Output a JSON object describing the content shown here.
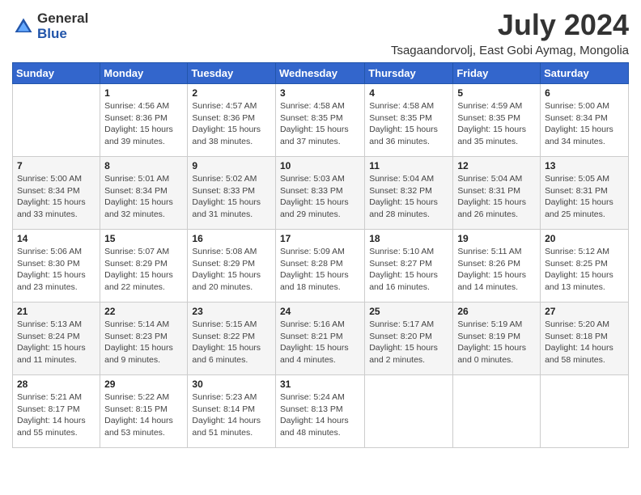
{
  "logo": {
    "general": "General",
    "blue": "Blue"
  },
  "title": "July 2024",
  "subtitle": "Tsagaandorvolj, East Gobi Aymag, Mongolia",
  "days_of_week": [
    "Sunday",
    "Monday",
    "Tuesday",
    "Wednesday",
    "Thursday",
    "Friday",
    "Saturday"
  ],
  "weeks": [
    [
      {
        "num": "",
        "info": ""
      },
      {
        "num": "1",
        "info": "Sunrise: 4:56 AM\nSunset: 8:36 PM\nDaylight: 15 hours\nand 39 minutes."
      },
      {
        "num": "2",
        "info": "Sunrise: 4:57 AM\nSunset: 8:36 PM\nDaylight: 15 hours\nand 38 minutes."
      },
      {
        "num": "3",
        "info": "Sunrise: 4:58 AM\nSunset: 8:35 PM\nDaylight: 15 hours\nand 37 minutes."
      },
      {
        "num": "4",
        "info": "Sunrise: 4:58 AM\nSunset: 8:35 PM\nDaylight: 15 hours\nand 36 minutes."
      },
      {
        "num": "5",
        "info": "Sunrise: 4:59 AM\nSunset: 8:35 PM\nDaylight: 15 hours\nand 35 minutes."
      },
      {
        "num": "6",
        "info": "Sunrise: 5:00 AM\nSunset: 8:34 PM\nDaylight: 15 hours\nand 34 minutes."
      }
    ],
    [
      {
        "num": "7",
        "info": "Sunrise: 5:00 AM\nSunset: 8:34 PM\nDaylight: 15 hours\nand 33 minutes."
      },
      {
        "num": "8",
        "info": "Sunrise: 5:01 AM\nSunset: 8:34 PM\nDaylight: 15 hours\nand 32 minutes."
      },
      {
        "num": "9",
        "info": "Sunrise: 5:02 AM\nSunset: 8:33 PM\nDaylight: 15 hours\nand 31 minutes."
      },
      {
        "num": "10",
        "info": "Sunrise: 5:03 AM\nSunset: 8:33 PM\nDaylight: 15 hours\nand 29 minutes."
      },
      {
        "num": "11",
        "info": "Sunrise: 5:04 AM\nSunset: 8:32 PM\nDaylight: 15 hours\nand 28 minutes."
      },
      {
        "num": "12",
        "info": "Sunrise: 5:04 AM\nSunset: 8:31 PM\nDaylight: 15 hours\nand 26 minutes."
      },
      {
        "num": "13",
        "info": "Sunrise: 5:05 AM\nSunset: 8:31 PM\nDaylight: 15 hours\nand 25 minutes."
      }
    ],
    [
      {
        "num": "14",
        "info": "Sunrise: 5:06 AM\nSunset: 8:30 PM\nDaylight: 15 hours\nand 23 minutes."
      },
      {
        "num": "15",
        "info": "Sunrise: 5:07 AM\nSunset: 8:29 PM\nDaylight: 15 hours\nand 22 minutes."
      },
      {
        "num": "16",
        "info": "Sunrise: 5:08 AM\nSunset: 8:29 PM\nDaylight: 15 hours\nand 20 minutes."
      },
      {
        "num": "17",
        "info": "Sunrise: 5:09 AM\nSunset: 8:28 PM\nDaylight: 15 hours\nand 18 minutes."
      },
      {
        "num": "18",
        "info": "Sunrise: 5:10 AM\nSunset: 8:27 PM\nDaylight: 15 hours\nand 16 minutes."
      },
      {
        "num": "19",
        "info": "Sunrise: 5:11 AM\nSunset: 8:26 PM\nDaylight: 15 hours\nand 14 minutes."
      },
      {
        "num": "20",
        "info": "Sunrise: 5:12 AM\nSunset: 8:25 PM\nDaylight: 15 hours\nand 13 minutes."
      }
    ],
    [
      {
        "num": "21",
        "info": "Sunrise: 5:13 AM\nSunset: 8:24 PM\nDaylight: 15 hours\nand 11 minutes."
      },
      {
        "num": "22",
        "info": "Sunrise: 5:14 AM\nSunset: 8:23 PM\nDaylight: 15 hours\nand 9 minutes."
      },
      {
        "num": "23",
        "info": "Sunrise: 5:15 AM\nSunset: 8:22 PM\nDaylight: 15 hours\nand 6 minutes."
      },
      {
        "num": "24",
        "info": "Sunrise: 5:16 AM\nSunset: 8:21 PM\nDaylight: 15 hours\nand 4 minutes."
      },
      {
        "num": "25",
        "info": "Sunrise: 5:17 AM\nSunset: 8:20 PM\nDaylight: 15 hours\nand 2 minutes."
      },
      {
        "num": "26",
        "info": "Sunrise: 5:19 AM\nSunset: 8:19 PM\nDaylight: 15 hours\nand 0 minutes."
      },
      {
        "num": "27",
        "info": "Sunrise: 5:20 AM\nSunset: 8:18 PM\nDaylight: 14 hours\nand 58 minutes."
      }
    ],
    [
      {
        "num": "28",
        "info": "Sunrise: 5:21 AM\nSunset: 8:17 PM\nDaylight: 14 hours\nand 55 minutes."
      },
      {
        "num": "29",
        "info": "Sunrise: 5:22 AM\nSunset: 8:15 PM\nDaylight: 14 hours\nand 53 minutes."
      },
      {
        "num": "30",
        "info": "Sunrise: 5:23 AM\nSunset: 8:14 PM\nDaylight: 14 hours\nand 51 minutes."
      },
      {
        "num": "31",
        "info": "Sunrise: 5:24 AM\nSunset: 8:13 PM\nDaylight: 14 hours\nand 48 minutes."
      },
      {
        "num": "",
        "info": ""
      },
      {
        "num": "",
        "info": ""
      },
      {
        "num": "",
        "info": ""
      }
    ]
  ]
}
